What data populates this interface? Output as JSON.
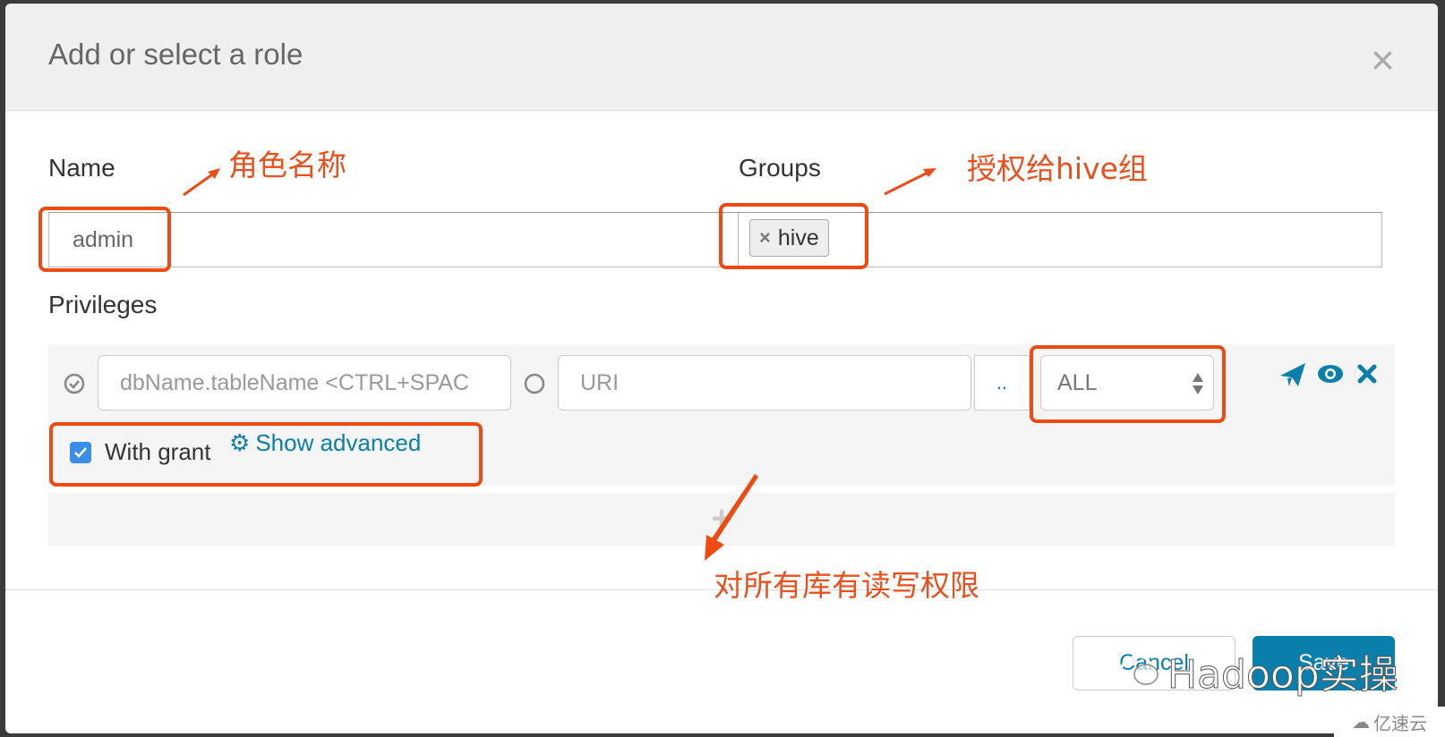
{
  "dialog": {
    "title": "Add or select a role",
    "close_label": "×"
  },
  "form": {
    "name_label": "Name",
    "name_value": "admin",
    "groups_label": "Groups",
    "groups": [
      {
        "label": "hive",
        "remove_icon": "×"
      }
    ],
    "privileges_label": "Privileges"
  },
  "privilege": {
    "db_placeholder": "dbName.tableName <CTRL+SPAC",
    "uri_placeholder": "URI",
    "browse_label": "..",
    "action_value": "ALL",
    "with_grant_label": "With grant",
    "with_grant_checked": true,
    "show_advanced_label": "Show advanced",
    "add_label": "+"
  },
  "footer": {
    "cancel_label": "Cancel",
    "save_label": "Save"
  },
  "annotations": {
    "name_note": "角色名称",
    "groups_note": "授权给hive组",
    "privilege_note": "对所有库有读写权限"
  },
  "watermarks": {
    "wechat": "Hadoop实操",
    "site": "亿速云"
  },
  "colors": {
    "accent": "#0b7fab",
    "annotation": "#ee4a12",
    "header_bg": "#efefef"
  }
}
